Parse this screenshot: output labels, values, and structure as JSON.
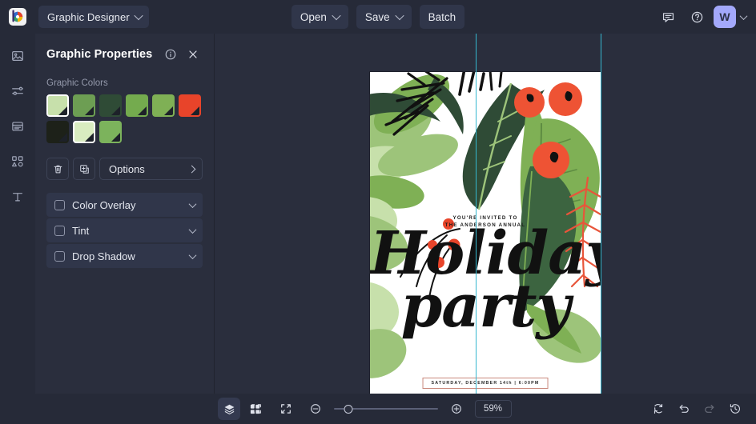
{
  "topbar": {
    "logo_icon": "color-wheel-logo-icon",
    "app_switcher": {
      "label": "Graphic Designer",
      "icon": "chevron-down-icon"
    },
    "buttons": [
      {
        "label": "Open",
        "icon": "chevron-down-icon",
        "name": "open-button"
      },
      {
        "label": "Save",
        "icon": "chevron-down-icon",
        "name": "save-button"
      },
      {
        "label": "Batch",
        "icon": "",
        "name": "batch-button"
      }
    ],
    "right_icons": [
      {
        "name": "feedback-icon",
        "title": "Feedback"
      },
      {
        "name": "help-icon",
        "title": "Help"
      }
    ],
    "avatar": {
      "initial": "W",
      "color": "#a3a8fb"
    }
  },
  "rail": {
    "items": [
      {
        "name": "sidebar-item-image",
        "icon": "image-icon"
      },
      {
        "name": "sidebar-item-adjustments",
        "icon": "sliders-icon"
      },
      {
        "name": "sidebar-item-layout",
        "icon": "layout-icon"
      },
      {
        "name": "sidebar-item-shapes",
        "icon": "shapes-icon"
      },
      {
        "name": "sidebar-item-text",
        "icon": "text-icon"
      }
    ]
  },
  "panel": {
    "title": "Graphic Properties",
    "info_icon": "info-icon",
    "close_icon": "close-icon",
    "colors_label": "Graphic Colors",
    "swatches": [
      {
        "color": "#c7e0ab",
        "selected": true
      },
      {
        "color": "#6d9e53",
        "selected": false
      },
      {
        "color": "#2f4b36",
        "selected": false
      },
      {
        "color": "#74ab4e",
        "selected": false
      },
      {
        "color": "#7fb055",
        "selected": false
      },
      {
        "color": "#e8442a",
        "selected": false
      },
      {
        "color": "#1d2119",
        "selected": false
      },
      {
        "color": "#d9ecc0",
        "selected": true
      },
      {
        "color": "#7cb35c",
        "selected": false
      }
    ],
    "delete_icon": "trash-icon",
    "duplicate_icon": "duplicate-icon",
    "options_label": "Options",
    "options_chevron": "chevron-right-icon",
    "effects": [
      {
        "label": "Color Overlay",
        "checked": false,
        "name": "effect-color-overlay"
      },
      {
        "label": "Tint",
        "checked": false,
        "name": "effect-tint"
      },
      {
        "label": "Drop Shadow",
        "checked": false,
        "name": "effect-drop-shadow"
      }
    ]
  },
  "canvas": {
    "guide_color": "#35b7cf",
    "document": {
      "invite_line1": "YOU'RE INVITED TO",
      "invite_line2": "THE ANDERSON ANNUAL",
      "headline_line1": "Holiday",
      "headline_line2": "party",
      "date_text": "SATURDAY, DECEMBER 14th | 6:00PM",
      "palette": {
        "light_green": "#c7e0ab",
        "mid_green": "#7fb055",
        "dark_green": "#2f4b36",
        "sage": "#9dc47a",
        "red": "#e8442a",
        "berry_red": "#ee5334",
        "black": "#111111",
        "cream": "#eef4e4"
      }
    }
  },
  "bottombar": {
    "layers_icon": "layers-icon",
    "grid_icon": "grid-icon",
    "fit_icon": "fit-to-screen-icon",
    "contract_icon": "contract-icon",
    "zoom_out_icon": "zoom-out-icon",
    "zoom_in_icon": "zoom-in-icon",
    "zoom_value": "59%",
    "slider_percent": 14,
    "reset_icon": "reset-icon",
    "undo_icon": "undo-icon",
    "redo_icon": "redo-icon",
    "history_icon": "history-icon"
  }
}
